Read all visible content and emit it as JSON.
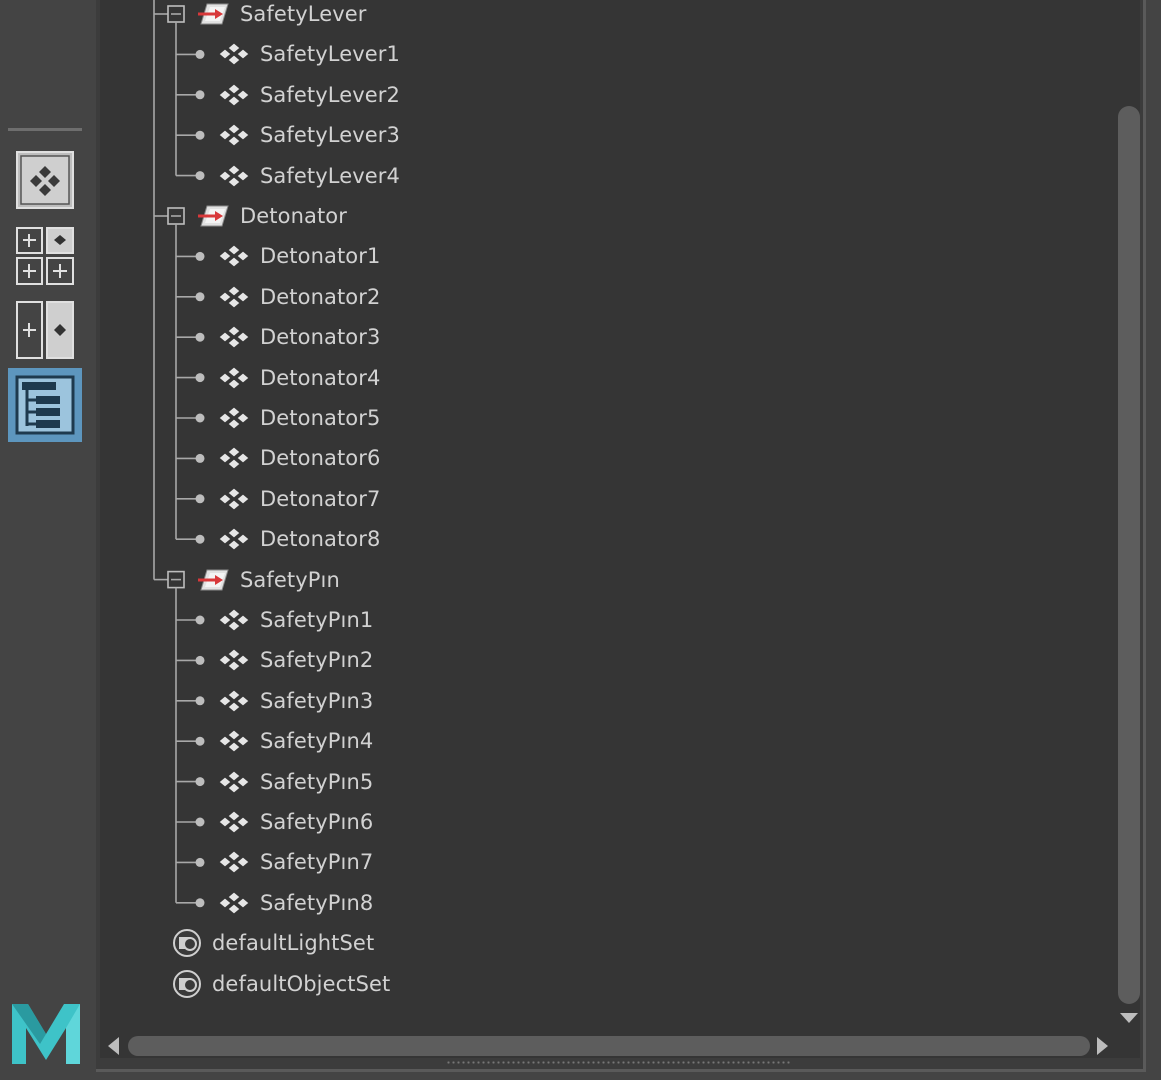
{
  "toolbar": {
    "buttons": [
      {
        "name": "single-view-button",
        "icon": "single-view-icon",
        "active": false
      },
      {
        "name": "four-view-button",
        "icon": "four-view-layout-icon",
        "active": false
      },
      {
        "name": "two-view-button",
        "icon": "two-view-layout-icon",
        "active": false
      },
      {
        "name": "outliner-button",
        "icon": "outliner-icon",
        "active": true
      }
    ],
    "logo": "maya-logo"
  },
  "outliner": {
    "groups": [
      {
        "label": "SafetyLever",
        "icon": "set-icon",
        "collapsed": false,
        "children": [
          "SafetyLever1",
          "SafetyLever2",
          "SafetyLever3",
          "SafetyLever4"
        ]
      },
      {
        "label": "Detonator",
        "icon": "set-icon",
        "collapsed": false,
        "children": [
          "Detonator1",
          "Detonator2",
          "Detonator3",
          "Detonator4",
          "Detonator5",
          "Detonator6",
          "Detonator7",
          "Detonator8"
        ]
      },
      {
        "label": "SafetyPın",
        "icon": "set-icon",
        "collapsed": false,
        "children": [
          "SafetyPın1",
          "SafetyPın2",
          "SafetyPın3",
          "SafetyPın4",
          "SafetyPın5",
          "SafetyPın6",
          "SafetyPın7",
          "SafetyPın8"
        ]
      }
    ],
    "root_items": [
      {
        "label": "defaultLightSet",
        "icon": "object-set-icon"
      },
      {
        "label": "defaultObjectSet",
        "icon": "object-set-icon"
      }
    ]
  },
  "colors": {
    "panel_bg": "#353535",
    "text": "#d2d2d2",
    "active_button": "#5d96be",
    "set_icon_red": "#d8383a",
    "logo_teal": "#3ec3c8"
  }
}
